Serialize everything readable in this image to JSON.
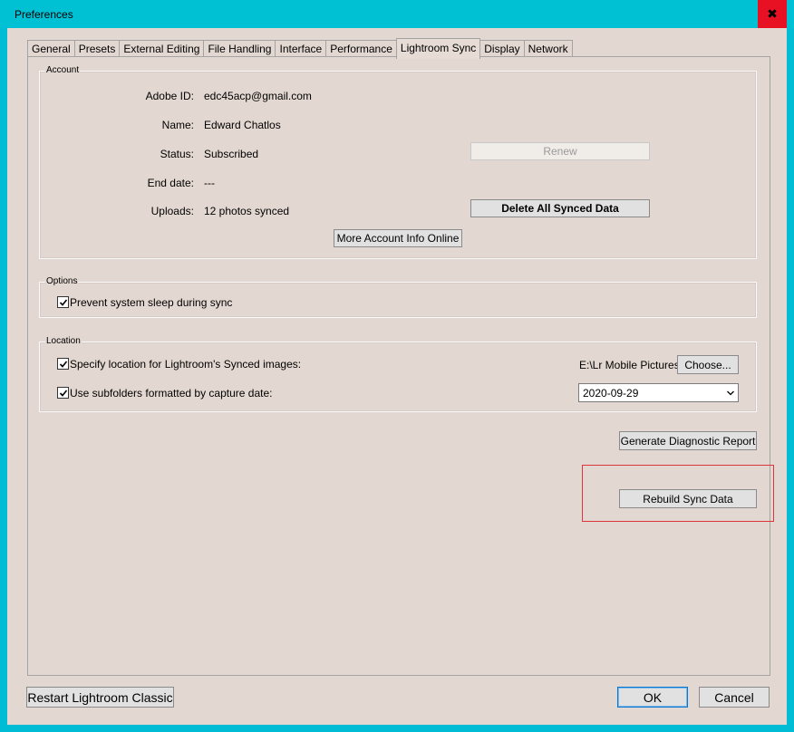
{
  "window": {
    "title": "Preferences",
    "close_glyph": "✖"
  },
  "tabs": [
    {
      "label": "General"
    },
    {
      "label": "Presets"
    },
    {
      "label": "External Editing"
    },
    {
      "label": "File Handling"
    },
    {
      "label": "Interface"
    },
    {
      "label": "Performance"
    },
    {
      "label": "Lightroom Sync",
      "active": true
    },
    {
      "label": "Display"
    },
    {
      "label": "Network"
    }
  ],
  "account": {
    "group_label": "Account",
    "adobe_id_label": "Adobe ID:",
    "adobe_id_value": "edc45acp@gmail.com",
    "name_label": "Name:",
    "name_value": "Edward Chatlos",
    "status_label": "Status:",
    "status_value": "Subscribed",
    "end_date_label": "End date:",
    "end_date_value": "---",
    "uploads_label": "Uploads:",
    "uploads_value": "12 photos synced",
    "renew_button": "Renew",
    "delete_button": "Delete All Synced Data",
    "more_info_button": "More Account Info Online"
  },
  "options": {
    "group_label": "Options",
    "prevent_sleep_label": "Prevent system sleep during sync",
    "prevent_sleep_checked": true
  },
  "location": {
    "group_label": "Location",
    "specify_label": "Specify location for Lightroom's Synced images:",
    "specify_checked": true,
    "path_value": "E:\\Lr Mobile Pictures",
    "choose_button": "Choose...",
    "subfolders_label": "Use subfolders formatted by capture date:",
    "subfolders_checked": true,
    "date_format_value": "2020-09-29"
  },
  "diagnostics": {
    "generate_button": "Generate Diagnostic Report",
    "rebuild_button": "Rebuild Sync Data",
    "highlight_color": "#e0343c"
  },
  "footer": {
    "restart_button": "Restart Lightroom Classic",
    "ok_button": "OK",
    "cancel_button": "Cancel"
  },
  "colors": {
    "titlebar": "#00c0d4",
    "close": "#e81123",
    "dialog_bg": "#e3d8d1"
  }
}
